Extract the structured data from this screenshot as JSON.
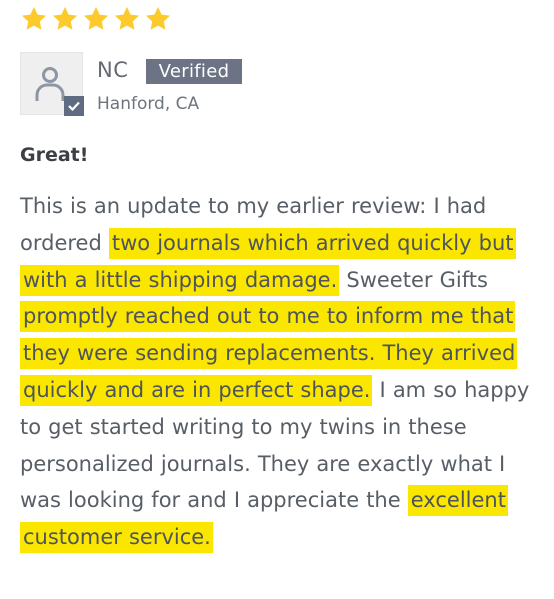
{
  "rating": {
    "stars": 5,
    "max": 5,
    "star_color": "#fccb2b"
  },
  "reviewer": {
    "initials": "NC",
    "badge": "Verified",
    "location": "Hanford, CA",
    "avatar_icon": "person-icon",
    "check_icon": "check-icon"
  },
  "review": {
    "title": "Great!",
    "highlight_color": "#fbe600",
    "segments": [
      {
        "text": "This is an update to my earlier review: I had ordered ",
        "highlight": false
      },
      {
        "text": "two journals which arrived quickly but with a little shipping damage.",
        "highlight": true
      },
      {
        "text": " Sweeter Gifts ",
        "highlight": false
      },
      {
        "text": "promptly reached out to me to inform me that they were sending replacements. They arrived quickly and are in perfect shape.",
        "highlight": true
      },
      {
        "text": " I am so happy to get started writing to my twins in these personalized journals. They are exactly what I was looking for and I appreciate the ",
        "highlight": false
      },
      {
        "text": "excellent customer service.",
        "highlight": true
      }
    ]
  }
}
